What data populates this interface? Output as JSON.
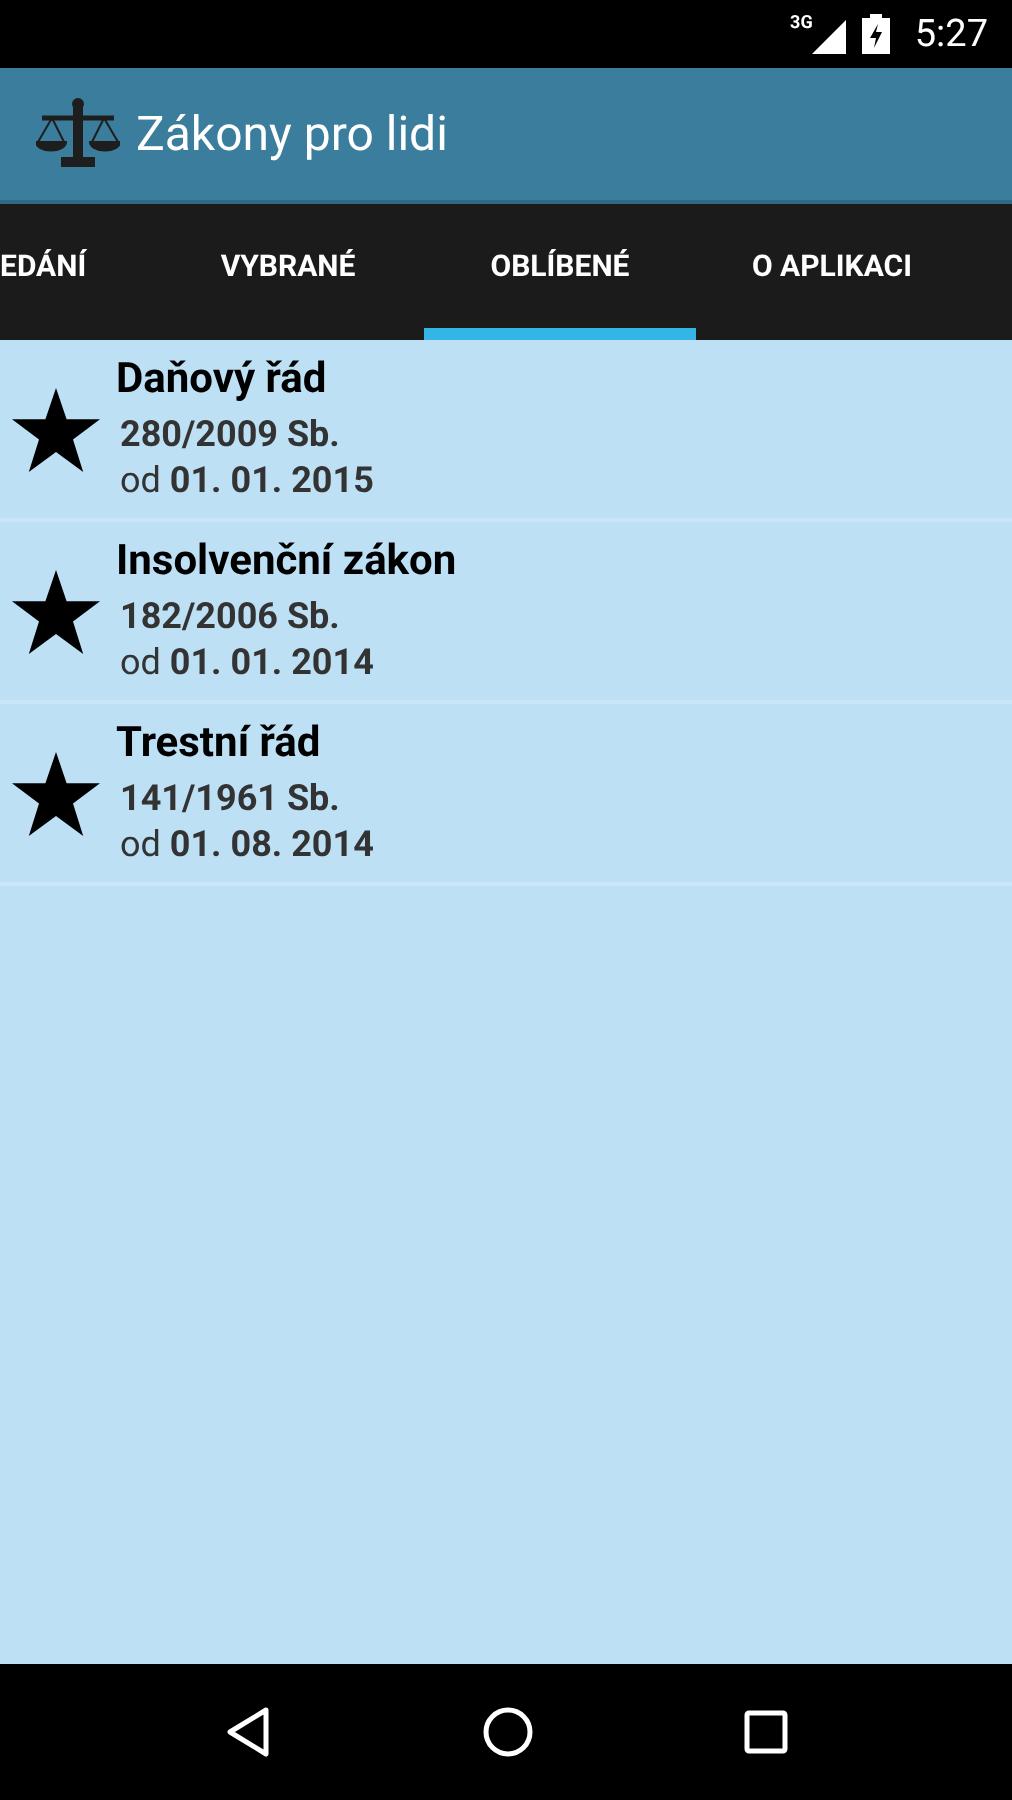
{
  "status_bar": {
    "network": "3G",
    "time": "5:27"
  },
  "app_bar": {
    "title": "Zákony pro lidi"
  },
  "tabs": [
    {
      "label": "EDÁNÍ",
      "selected": false
    },
    {
      "label": "VYBRANÉ",
      "selected": false
    },
    {
      "label": "OBLÍBENÉ",
      "selected": true
    },
    {
      "label": "O APLIKACI",
      "selected": false
    }
  ],
  "laws": [
    {
      "title": "Daňový řád",
      "number": "280/2009 Sb.",
      "effective": "od **01. 01. 2015**"
    },
    {
      "title": "Insolvenční zákon",
      "number": "182/2006 Sb.",
      "effective": "od **01. 01. 2014**"
    },
    {
      "title": "Trestní řád",
      "number": "141/1961 Sb.",
      "effective": "od **01. 08. 2014**"
    }
  ]
}
